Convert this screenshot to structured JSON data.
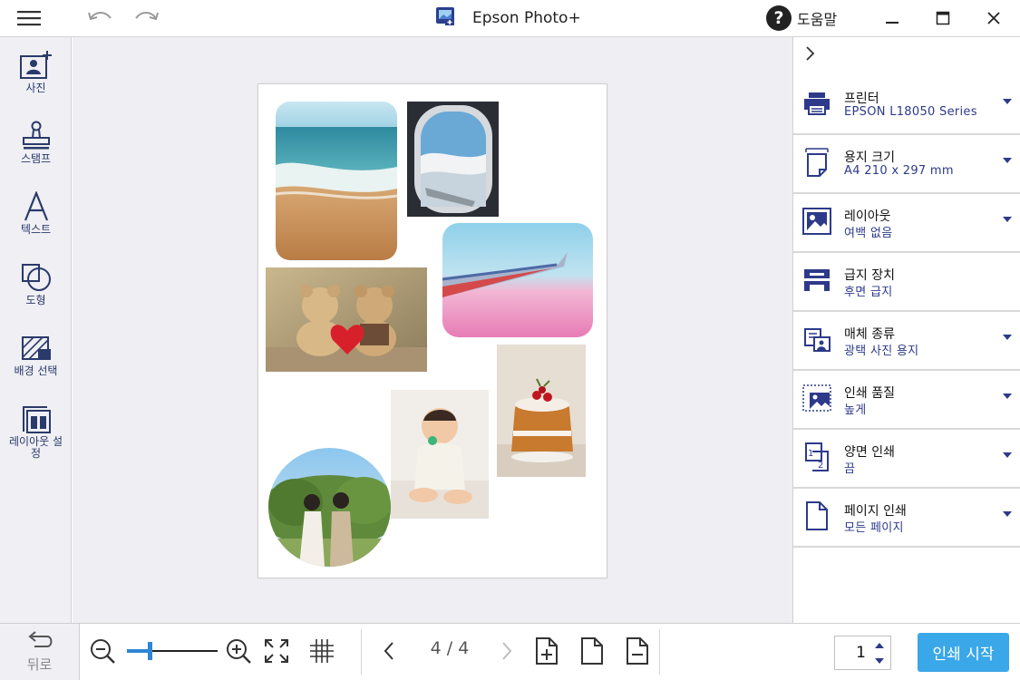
{
  "titlebar": {
    "app_title": "Epson Photo+",
    "help_label": "도움말",
    "menu_icon": "hamburger-icon",
    "undo_icon": "undo-icon",
    "redo_icon": "redo-icon",
    "minimize_icon": "minimize-icon",
    "maximize_icon": "maximize-icon",
    "close_icon": "close-icon"
  },
  "left_tools": [
    {
      "id": "photo",
      "label": "사진",
      "icon": "add-photo-icon"
    },
    {
      "id": "stamp",
      "label": "스탬프",
      "icon": "stamp-icon"
    },
    {
      "id": "text",
      "label": "텍스트",
      "icon": "text-icon"
    },
    {
      "id": "shape",
      "label": "도형",
      "icon": "shape-icon"
    },
    {
      "id": "background",
      "label": "배경 선택",
      "icon": "background-icon"
    },
    {
      "id": "layout",
      "label": "레이아웃 설정",
      "icon": "layout-icon"
    }
  ],
  "canvas": {
    "photos": [
      {
        "name": "beach-photo",
        "subject": "beach waves"
      },
      {
        "name": "airplane-window-photo",
        "subject": "airplane window view"
      },
      {
        "name": "airplane-wing-photo",
        "subject": "airplane wing over pink clouds"
      },
      {
        "name": "teddy-bears-photo",
        "subject": "teddy bears with heart"
      },
      {
        "name": "cake-photo",
        "subject": "cake with cherries"
      },
      {
        "name": "baby-photo",
        "subject": "baby sitting"
      },
      {
        "name": "couple-photo",
        "subject": "couple in garden"
      }
    ]
  },
  "settings": [
    {
      "id": "printer",
      "title": "프린터",
      "value": "EPSON L18050 Series",
      "icon": "printer-icon"
    },
    {
      "id": "paper_size",
      "title": "용지 크기",
      "value": "A4 210 x 297 mm",
      "icon": "paper-size-icon"
    },
    {
      "id": "layout",
      "title": "레이아웃",
      "value": "여백 없음",
      "icon": "layout-image-icon"
    },
    {
      "id": "paper_source",
      "title": "급지 장치",
      "value": "후면 급지",
      "icon": "paper-source-icon"
    },
    {
      "id": "media_type",
      "title": "매체 종류",
      "value": "광택 사진 용지",
      "icon": "media-type-icon"
    },
    {
      "id": "print_quality",
      "title": "인쇄 품질",
      "value": "높게",
      "icon": "print-quality-icon"
    },
    {
      "id": "duplex",
      "title": "양면 인쇄",
      "value": "끔",
      "icon": "duplex-icon"
    },
    {
      "id": "page_print",
      "title": "페이지 인쇄",
      "value": "모든 페이지",
      "icon": "page-icon"
    }
  ],
  "bottombar": {
    "back_label": "뒤로",
    "zoom_percent": 25,
    "page_indicator": "4 / 4",
    "copies": "1",
    "print_label": "인쇄 시작"
  },
  "colors": {
    "accent": "#3aa7e8",
    "navy": "#2d3a8a",
    "sidebar_bg": "#efeff4"
  }
}
